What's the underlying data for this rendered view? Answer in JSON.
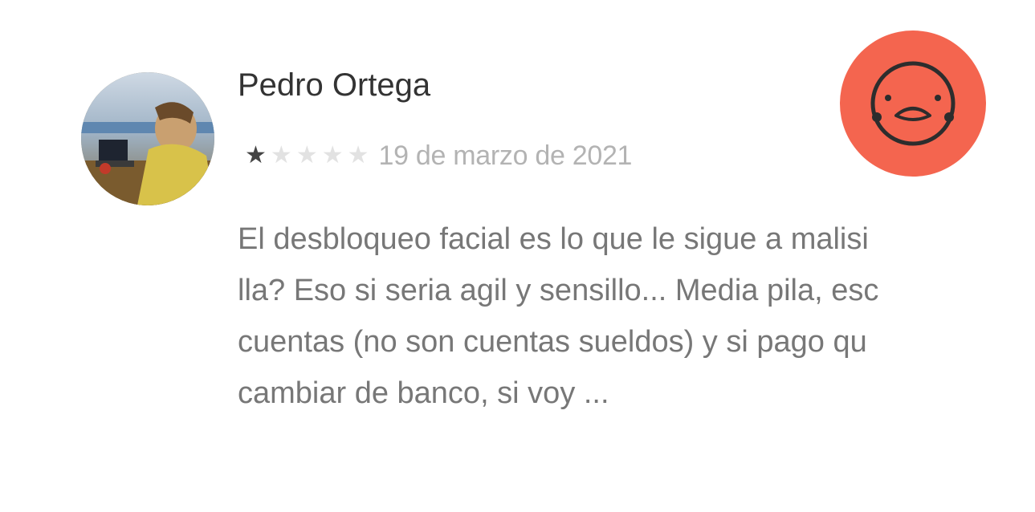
{
  "review": {
    "author": "Pedro Ortega",
    "rating": 1,
    "rating_max": 5,
    "date": "19 de marzo de 2021",
    "text_lines": [
      "El desbloqueo facial es lo que le sigue a malisi",
      "lla? Eso si seria agil y sensillo... Media pila, esc",
      "cuentas (no son cuentas sueldos) y si pago qu",
      "cambiar de banco, si voy ..."
    ]
  },
  "icons": {
    "avatar": "user-photo-avatar",
    "sentiment": "sad-face-icon",
    "star": "star-icon"
  },
  "colors": {
    "sentiment_badge": "#f4654f",
    "star_filled": "#444444",
    "star_empty": "#e2e2e2",
    "author_text": "#333333",
    "date_text": "#b3b3b3",
    "body_text": "#777777"
  }
}
